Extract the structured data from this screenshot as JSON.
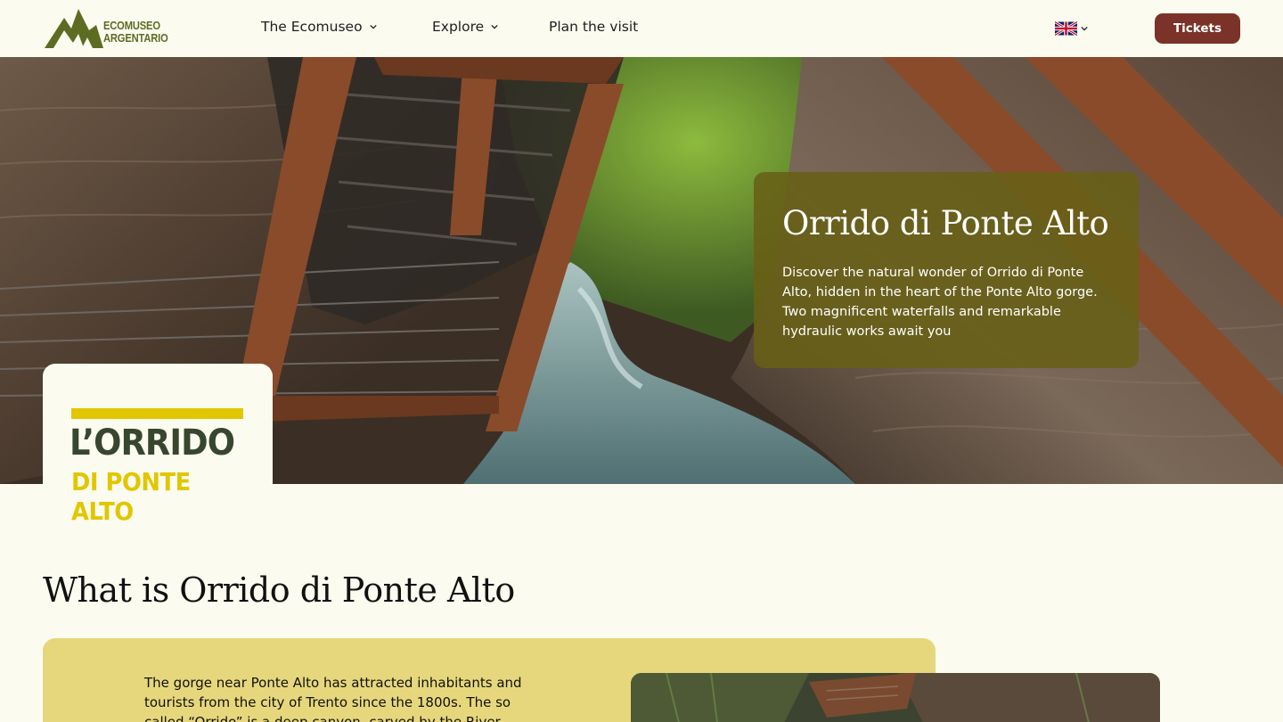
{
  "header": {
    "logo_text_line1": "ECOMUSEO",
    "logo_text_line2": "ARGENTARIO",
    "nav": [
      {
        "label": "The Ecomuseo"
      },
      {
        "label": "Explore"
      },
      {
        "label": "Plan the visit"
      }
    ],
    "language_icon": "uk-flag-icon",
    "tickets_label": "Tickets"
  },
  "hero": {
    "title": "Orrido di Ponte Alto",
    "description": "Discover the natural wonder of Orrido di Ponte Alto, hidden in the heart of the Ponte Alto gorge. Two magnificent waterfalls and remarkable hydraulic works await you",
    "badge_line1": "L’ORRIDO",
    "badge_line2": "DI PONTE ALTO"
  },
  "section": {
    "title": "What is Orrido di Ponte Alto",
    "intro": "The gorge near Ponte Alto has attracted inhabitants and tourists from the city of Trento since the 1800s. The so called “Orrido” is a deep canyon, carved by the River"
  },
  "colors": {
    "background": "#fbfcef",
    "brand_green": "#5e6b23",
    "tickets_button": "#7b3229",
    "hero_card": "#686016",
    "badge_yellow": "#e2c600",
    "panel_yellow": "#e7d77c"
  }
}
